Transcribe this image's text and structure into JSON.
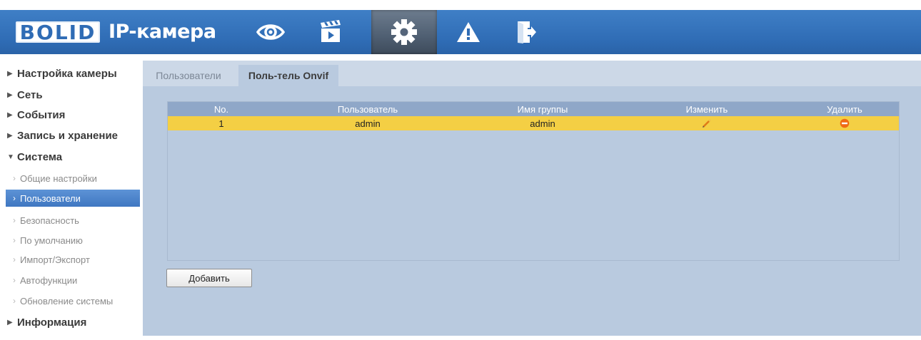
{
  "header": {
    "logo_text": "BOLID",
    "title": "IP-камера",
    "nav_icons": [
      "eye-icon",
      "clapperboard-icon",
      "gear-icon",
      "warning-icon",
      "logout-icon"
    ],
    "active_nav": "gear-icon",
    "color": "#2f6cb5"
  },
  "sidebar": {
    "sections": [
      {
        "label": "Настройка камеры",
        "expanded": false
      },
      {
        "label": "Сеть",
        "expanded": false
      },
      {
        "label": "События",
        "expanded": false
      },
      {
        "label": "Запись и хранение",
        "expanded": false
      },
      {
        "label": "Система",
        "expanded": true
      },
      {
        "label": "Информация",
        "expanded": false
      }
    ],
    "system_items": [
      {
        "label": "Общие настройки"
      },
      {
        "label": "Пользователи",
        "active": true
      },
      {
        "label": "Безопасность"
      },
      {
        "label": "По умолчанию"
      },
      {
        "label": "Импорт/Экспорт"
      },
      {
        "label": "Автофункции"
      },
      {
        "label": "Обновление системы"
      }
    ],
    "active_color": "#4a84cc"
  },
  "tabs": [
    {
      "label": "Пользователи",
      "active": false
    },
    {
      "label": "Поль-тель Onvif",
      "active": true
    }
  ],
  "table": {
    "columns": [
      "No.",
      "Пользователь",
      "Имя группы",
      "Изменить",
      "Удалить"
    ],
    "rows": [
      {
        "no": "1",
        "user": "admin",
        "group": "admin",
        "edit_icon": "pencil-icon",
        "delete_icon": "delete-icon"
      }
    ],
    "header_color": "#8fa7c8",
    "selected_row_color": "#f4cf44"
  },
  "add_button": "Добавить"
}
